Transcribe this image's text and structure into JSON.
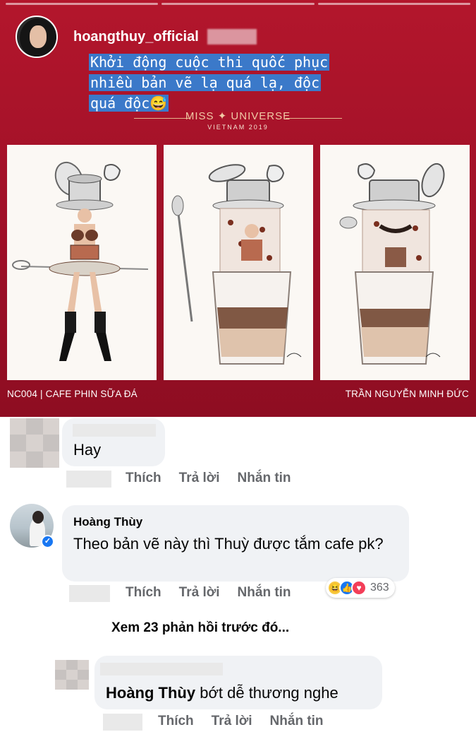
{
  "story": {
    "username": "hoangthuy_official",
    "caption_lines": [
      "Khởi động cuộc thi quốc phục",
      "nhiều bản vẽ lạ quá lạ, độc",
      "quá độc😅"
    ],
    "banner_title": "MISS ✦ UNIVERSE",
    "banner_sub": "VIETNAM 2019",
    "footer_left": "NC004 | CAFE PHIN SỮA ĐÁ",
    "footer_right": "TRẦN NGUYỄN MINH ĐỨC",
    "colors": {
      "background": "#a8132a",
      "caption_highlight": "#3b79c9"
    }
  },
  "comments": [
    {
      "text": "Hay",
      "actions": [
        "Thích",
        "Trả lời",
        "Nhắn tin"
      ]
    },
    {
      "name": "Hoàng Thùy",
      "text": "Theo bản vẽ này thì Thuỳ  được tắm cafe pk?",
      "actions": [
        "Thích",
        "Trả lời",
        "Nhắn tin"
      ],
      "reactions": {
        "icons": [
          "haha-icon",
          "like-icon",
          "love-icon"
        ],
        "count": "363"
      }
    },
    {
      "mention": "Hoàng Thùy",
      "text": " bớt dễ thương nghe",
      "actions": [
        "Thích",
        "Trả lời",
        "Nhắn tin"
      ]
    }
  ],
  "view_more": "Xem 23 phản hồi trước đó...",
  "colors": {
    "bubble": "#f0f2f5",
    "action": "#65676b",
    "verified": "#1877f2"
  }
}
